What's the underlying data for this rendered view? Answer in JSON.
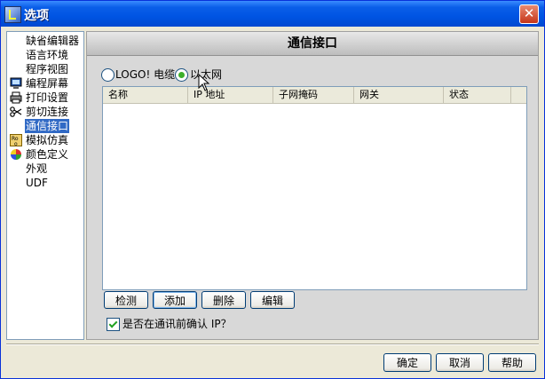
{
  "window": {
    "title": "选项",
    "close_glyph": "✕"
  },
  "tree": {
    "items": [
      {
        "label": "缺省编辑器",
        "icon": "none"
      },
      {
        "label": "语言环境",
        "icon": "none"
      },
      {
        "label": "程序视图",
        "icon": "none"
      },
      {
        "label": "编程屏幕",
        "icon": "monitor-icon"
      },
      {
        "label": "打印设置",
        "icon": "printer-icon"
      },
      {
        "label": "剪切连接",
        "icon": "scissors-icon"
      },
      {
        "label": "通信接口",
        "icon": "none",
        "selected": true
      },
      {
        "label": "模拟仿真",
        "icon": "simulation-icon"
      },
      {
        "label": "颜色定义",
        "icon": "color-wheel-icon"
      },
      {
        "label": "外观",
        "icon": "none"
      },
      {
        "label": "UDF",
        "icon": "none"
      }
    ]
  },
  "panel": {
    "header": "通信接口",
    "radio_logo_label": "LOGO! 电缆",
    "radio_ethernet_label": "以太网",
    "selected_radio": "ethernet",
    "columns": [
      "名称",
      "IP 地址",
      "子网掩码",
      "网关",
      "状态"
    ],
    "rows": [],
    "buttons": {
      "detect": "检测",
      "add": "添加",
      "delete": "删除",
      "edit": "编辑"
    },
    "confirm_ip_label": "是否在通讯前确认 IP？",
    "confirm_ip_checked": true
  },
  "footer": {
    "ok": "确定",
    "cancel": "取消",
    "help": "帮助"
  },
  "colors": {
    "titlebar": "#0054e3",
    "selection": "#316ac5",
    "panel_bg": "#d8d8d8",
    "radio_dot": "#3db02c"
  }
}
